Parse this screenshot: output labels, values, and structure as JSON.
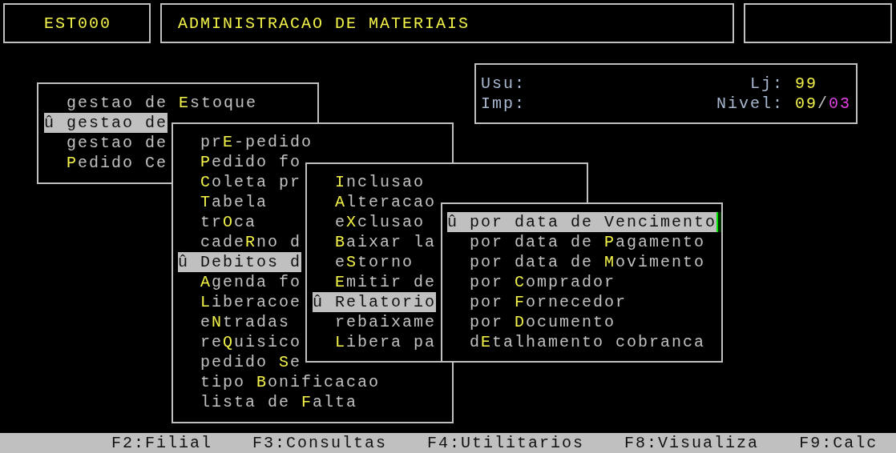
{
  "header": {
    "code": "EST000",
    "title": "ADMINISTRACAO DE MATERIAIS"
  },
  "info": {
    "user_label": "Usu:",
    "store_label": "Lj:",
    "store_value": "99",
    "printer_label": "Imp:",
    "nivel_label": "Nivel:",
    "nivel_value": "09",
    "nivel_sep": "/",
    "nivel_sub": "03"
  },
  "menus": [
    {
      "items": [
        {
          "pre": "gestao de ",
          "key": "E",
          "post": "stoque",
          "selected": false
        },
        {
          "marker": "û",
          "text": "gestao de",
          "selected": true
        },
        {
          "text": "gestao de",
          "selected": false
        },
        {
          "key": "P",
          "post": "edido Ce",
          "selected": false
        }
      ]
    },
    {
      "items": [
        {
          "pre": "pr",
          "key": "E",
          "post": "-pedido",
          "selected": false
        },
        {
          "key": "P",
          "post": "edido fo",
          "selected": false
        },
        {
          "key": "C",
          "post": "oleta pr",
          "selected": false
        },
        {
          "key": "T",
          "post": "abela",
          "selected": false
        },
        {
          "pre": "tr",
          "key": "O",
          "post": "ca",
          "selected": false
        },
        {
          "pre": "cade",
          "key": "R",
          "post": "no d",
          "selected": false
        },
        {
          "marker": "û",
          "text": "Debitos d",
          "selected": true
        },
        {
          "key": "A",
          "post": "genda fo",
          "selected": false
        },
        {
          "key": "L",
          "post": "iberacoe",
          "selected": false
        },
        {
          "pre": "e",
          "key": "N",
          "post": "tradas",
          "selected": false
        },
        {
          "pre": "re",
          "key": "Q",
          "post": "uisico",
          "selected": false
        },
        {
          "pre": "pedido ",
          "key": "S",
          "post": "e",
          "selected": false
        },
        {
          "pre": "tipo ",
          "key": "B",
          "post": "onificacao",
          "selected": false
        },
        {
          "pre": "lista de ",
          "key": "F",
          "post": "alta",
          "selected": false
        }
      ]
    },
    {
      "items": [
        {
          "key": "I",
          "post": "nclusao",
          "selected": false
        },
        {
          "key": "A",
          "post": "lteracao",
          "selected": false
        },
        {
          "pre": "e",
          "key": "X",
          "post": "clusao",
          "selected": false
        },
        {
          "key": "B",
          "post": "aixar la",
          "selected": false
        },
        {
          "pre": "e",
          "key": "S",
          "post": "torno",
          "selected": false
        },
        {
          "key": "E",
          "post": "mitir de",
          "selected": false
        },
        {
          "marker": "û",
          "text": "Relatorio",
          "selected": true
        },
        {
          "text": "rebaixame",
          "selected": false
        },
        {
          "key": "L",
          "post": "ibera pa",
          "selected": false
        }
      ]
    },
    {
      "items": [
        {
          "marker": "û",
          "text": "por data de Vencimento",
          "selected": true
        },
        {
          "pre": "por data de ",
          "key": "P",
          "post": "agamento",
          "selected": false
        },
        {
          "pre": "por data de ",
          "key": "M",
          "post": "ovimento",
          "selected": false
        },
        {
          "pre": "por ",
          "key": "C",
          "post": "omprador",
          "selected": false
        },
        {
          "pre": "por ",
          "key": "F",
          "post": "ornecedor",
          "selected": false
        },
        {
          "pre": "por ",
          "key": "D",
          "post": "ocumento",
          "selected": false
        },
        {
          "pre": "d",
          "key": "E",
          "post": "talhamento cobranca",
          "selected": false
        }
      ]
    }
  ],
  "function_keys": [
    "F2:Filial",
    "F3:Consultas",
    "F4:Utilitarios",
    "F8:Visualiza",
    "F9:Calc"
  ]
}
